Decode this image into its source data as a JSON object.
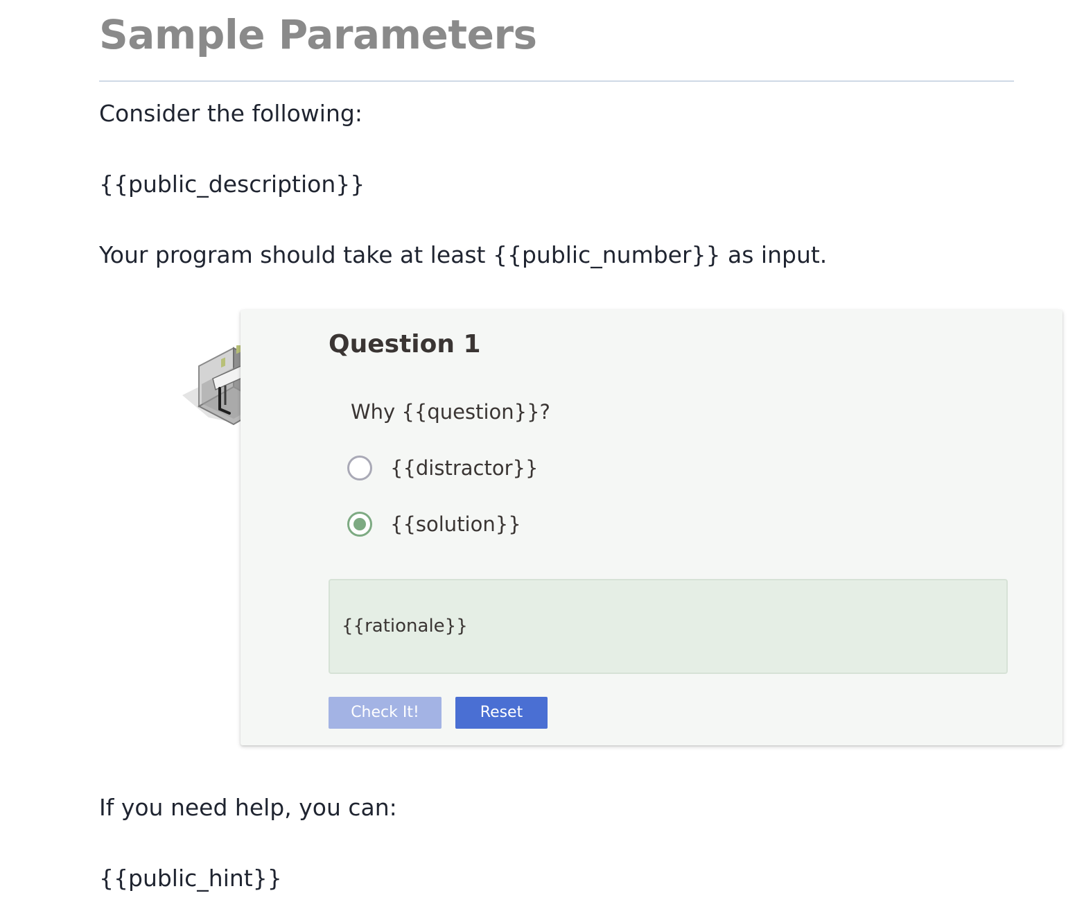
{
  "page": {
    "title": "Sample Parameters",
    "intro": "Consider the following:",
    "description": "{{public_description}}",
    "input_line": "Your program should take at least {{public_number}} as input.",
    "help_intro": "If you need help, you can:",
    "hint": "{{public_hint}}"
  },
  "question": {
    "title": "Question 1",
    "prompt": "Why {{question}}?",
    "options": [
      {
        "label": "{{distractor}}",
        "selected": false
      },
      {
        "label": "{{solution}}",
        "selected": true
      }
    ],
    "rationale": "{{rationale}}",
    "check_label": "Check It!",
    "reset_label": "Reset"
  },
  "colors": {
    "title_gray": "#8a8a8a",
    "card_background": "#f5f7f5",
    "rationale_background": "#e5eee5",
    "selected_radio": "#7daa82",
    "check_button": "#a3b3e4",
    "reset_button": "#4a6fd3"
  },
  "icons": {
    "question_badge": "isometric-cube-icon"
  }
}
